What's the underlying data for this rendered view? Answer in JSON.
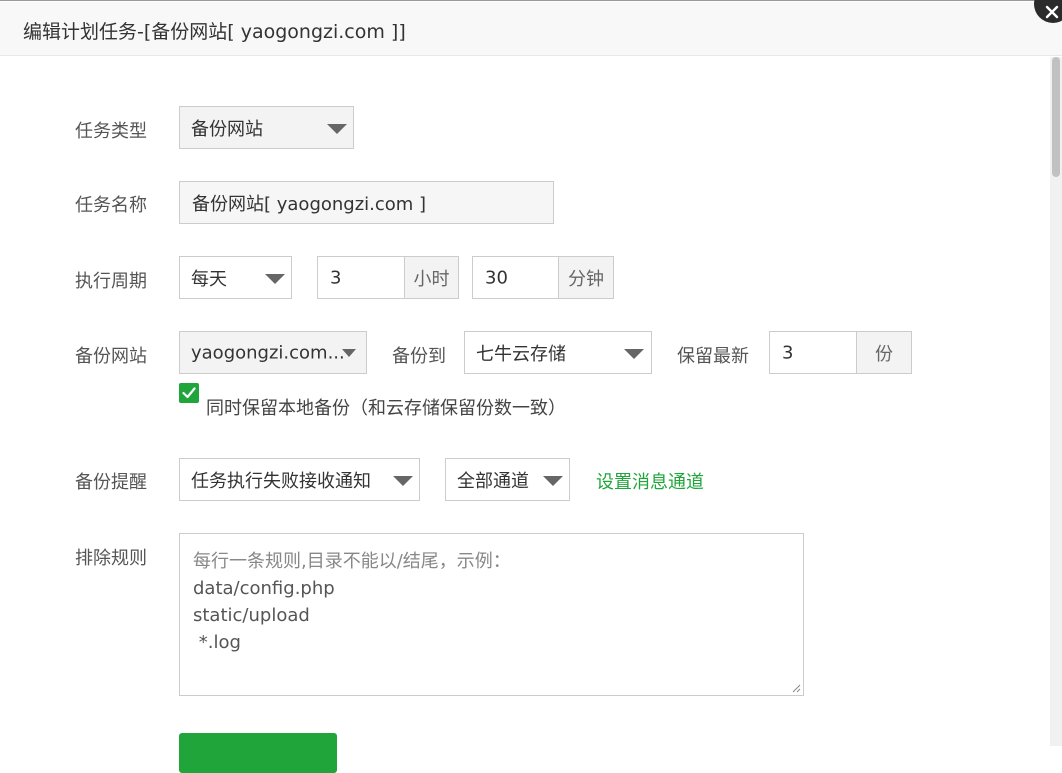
{
  "dialog": {
    "title": "编辑计划任务-[备份网站[ yaogongzi.com ]]"
  },
  "form": {
    "task_type": {
      "label": "任务类型",
      "value": "备份网站"
    },
    "task_name": {
      "label": "任务名称",
      "value": "备份网站[ yaogongzi.com ]"
    },
    "period": {
      "label": "执行周期",
      "cycle": "每天",
      "hour": "3",
      "hour_unit": "小时",
      "minute": "30",
      "minute_unit": "分钟"
    },
    "backup_site": {
      "label": "备份网站",
      "site": "yaogongzi.com...",
      "backup_to_label": "备份到",
      "backup_to": "七牛云存储",
      "keep_label": "保留最新",
      "keep_count": "3",
      "keep_unit": "份"
    },
    "local_backup": {
      "checked": true,
      "label": "同时保留本地备份（和云存储保留份数一致）"
    },
    "notify": {
      "label": "备份提醒",
      "value": "任务执行失败接收通知",
      "channel": "全部通道",
      "link": "设置消息通道"
    },
    "exclude": {
      "label": "排除规则",
      "placeholder": "每行一条规则,目录不能以/结尾，示例：",
      "lines": [
        "data/config.php",
        "static/upload",
        " *.log"
      ]
    }
  },
  "colors": {
    "accent": "#20a53a",
    "title_bg": "#f8f8f8",
    "border": "#cccccc"
  }
}
